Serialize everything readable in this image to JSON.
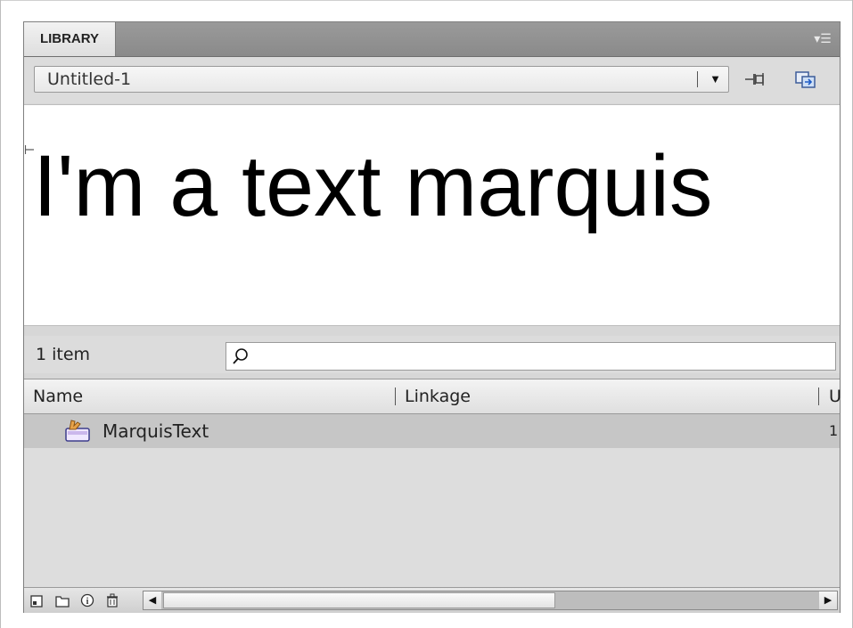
{
  "panel": {
    "tab_label": "LIBRARY",
    "menu_icon": "panel-menu-icon"
  },
  "document_select": {
    "value": "Untitled-1"
  },
  "toolbar_icons": [
    "pin-icon",
    "new-library-panel-icon"
  ],
  "preview": {
    "text": "I'm a text marquis"
  },
  "items": {
    "count_label": "1 item",
    "search_placeholder": ""
  },
  "list": {
    "columns": [
      "Name",
      "Linkage",
      "U"
    ],
    "rows": [
      {
        "name": "MarquisText",
        "extra": "1",
        "icon": "movie-clip-symbol-icon"
      }
    ]
  },
  "bottom_toolbar": {
    "icons": [
      "new-symbol-icon",
      "new-folder-icon",
      "properties-icon",
      "delete-icon"
    ]
  },
  "colors": {
    "panel_bg": "#d7d7d7",
    "tab_bar": "#8f8f8f",
    "selected_row": "#c6c6c6"
  }
}
